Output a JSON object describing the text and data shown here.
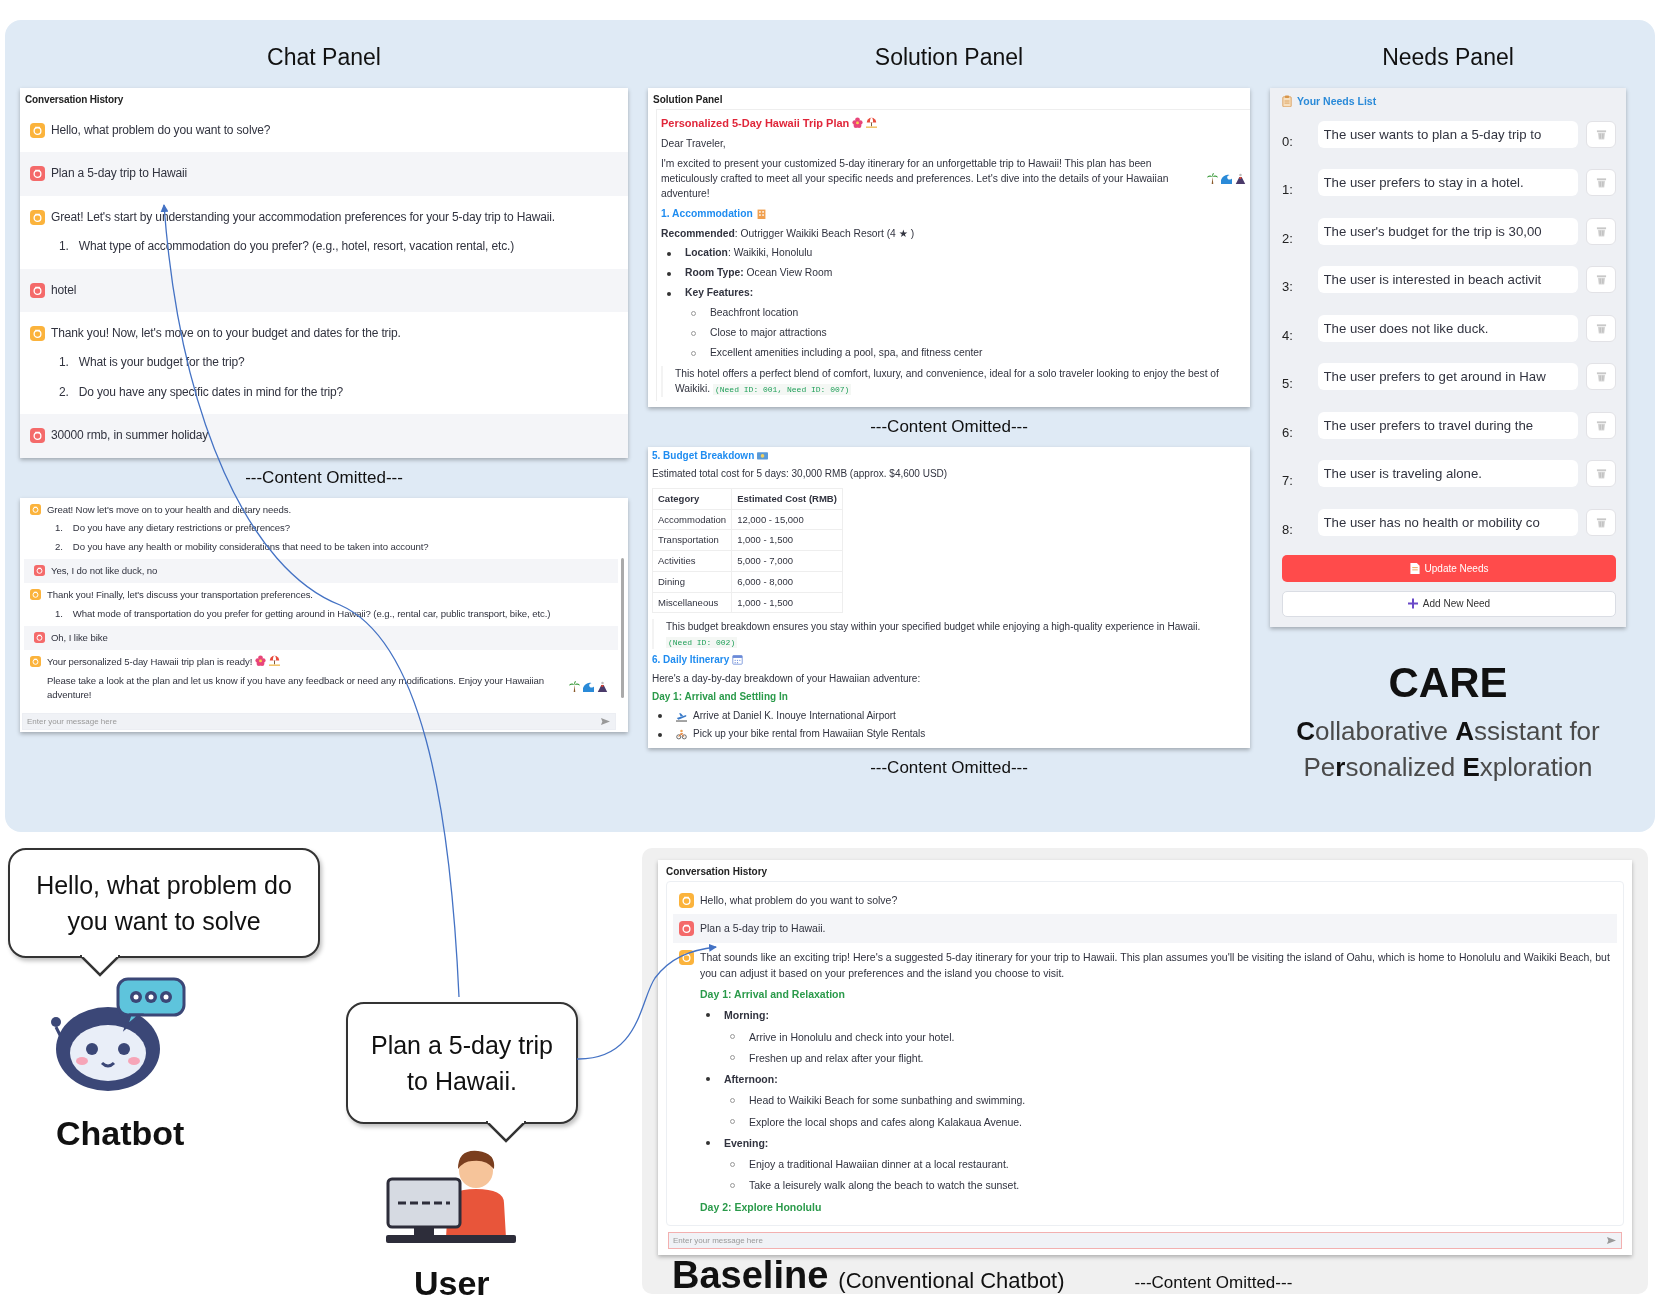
{
  "chat_panel": {
    "heading": "Chat Panel",
    "title": "Conversation History",
    "messages": [
      {
        "kind": "bot",
        "blocks": [
          {
            "kind": "paragraph",
            "text": "Hello, what problem do you want to solve?"
          }
        ]
      },
      {
        "kind": "user",
        "blocks": [
          {
            "kind": "paragraph",
            "text": "Plan a 5-day trip to Hawaii"
          }
        ]
      },
      {
        "kind": "bot",
        "blocks": [
          {
            "kind": "paragraph",
            "text": "Great! Let's start by understanding your accommodation preferences for your 5-day trip to Hawaii."
          },
          {
            "kind": "numbered",
            "number": "1.",
            "text": "What type of accommodation do you prefer? (e.g., hotel, resort, vacation rental, etc.)"
          }
        ]
      },
      {
        "kind": "user",
        "blocks": [
          {
            "kind": "paragraph",
            "text": "hotel"
          }
        ]
      },
      {
        "kind": "bot",
        "blocks": [
          {
            "kind": "paragraph",
            "text": "Thank you! Now, let's move on to your budget and dates for the trip."
          },
          {
            "kind": "numbered",
            "number": "1.",
            "text": "What is your budget for the trip?"
          },
          {
            "kind": "numbered",
            "number": "2.",
            "text": "Do you have any specific dates in mind for the trip?"
          }
        ]
      },
      {
        "kind": "user",
        "blocks": [
          {
            "kind": "paragraph",
            "text": "30000 rmb, in summer holiday"
          }
        ]
      }
    ],
    "omitted": "---Content Omitted---",
    "messages_2": [
      {
        "kind": "bot",
        "blocks": [
          {
            "kind": "paragraph",
            "text": "Great! Now let's move on to your health and dietary needs."
          },
          {
            "kind": "numbered",
            "number": "1.",
            "text": "Do you have any dietary restrictions or preferences?"
          },
          {
            "kind": "numbered",
            "number": "2.",
            "text": "Do you have any health or mobility considerations that need to be taken into account?"
          }
        ]
      },
      {
        "kind": "user",
        "blocks": [
          {
            "kind": "paragraph",
            "text": "Yes, I do not like duck, no"
          }
        ]
      },
      {
        "kind": "bot",
        "blocks": [
          {
            "kind": "paragraph",
            "text": "Thank you! Finally, let's discuss your transportation preferences."
          },
          {
            "kind": "numbered",
            "number": "1.",
            "text": "What mode of transportation do you prefer for getting around in Hawaii? (e.g., rental car, public transport, bike, etc.)"
          }
        ]
      },
      {
        "kind": "user",
        "blocks": [
          {
            "kind": "paragraph",
            "text": "Oh, I like bike"
          }
        ]
      },
      {
        "kind": "bot",
        "blocks": [
          {
            "kind": "paragraph",
            "text": "Your personalized 5-day Hawaii trip plan is ready!"
          },
          {
            "kind": "paragraph",
            "text": "Please take a look at the plan and let us know if you have any feedback or need any modifications. Enjoy your Hawaiian adventure!"
          }
        ]
      }
    ],
    "input_placeholder": "Enter your message here"
  },
  "solution_panel": {
    "heading": "Solution Panel",
    "title": "Solution Panel",
    "blocks_top": [
      {
        "kind": "title",
        "text": "Personalized 5-Day Hawaii Trip Plan"
      },
      {
        "kind": "paragraph",
        "text": "Dear Traveler,"
      },
      {
        "kind": "paragraph",
        "text": "I'm excited to present your customized 5-day itinerary for an unforgettable trip to Hawaii! This plan has been meticulously crafted to meet all your specific needs and preferences. Let's dive into the details of your Hawaiian adventure!"
      },
      {
        "kind": "section",
        "text": "1. Accommodation"
      },
      {
        "kind": "paragraph",
        "text": "**Recommended**: Outrigger Waikiki Beach Resort (4 ★ )"
      },
      {
        "kind": "bullet",
        "text": "**Location**: Waikiki, Honolulu"
      },
      {
        "kind": "bullet",
        "text": "**Room Type:** Ocean View Room"
      },
      {
        "kind": "heading_bullet",
        "text": "Key Features:"
      },
      {
        "kind": "subbullet",
        "text": "Beachfront location"
      },
      {
        "kind": "subbullet",
        "text": "Close to major attractions"
      },
      {
        "kind": "subbullet",
        "text": "Excellent amenities including a pool, spa, and fitness center"
      },
      {
        "kind": "note",
        "text": "This hotel offers a perfect blend of comfort, luxury, and convenience, ideal for a solo traveler looking to enjoy the best of Waikiki.",
        "tag": "(Need ID: 001, Need ID: 007)"
      }
    ],
    "omitted": "---Content Omitted---",
    "blocks_bottom": [
      {
        "kind": "section",
        "text": "5. Budget Breakdown"
      },
      {
        "kind": "paragraph",
        "text": "Estimated total cost for 5 days: 30,000 RMB (approx. $4,600 USD)"
      },
      {
        "kind": "table",
        "columns": [
          "Category",
          "Estimated Cost (RMB)"
        ],
        "rows": [
          [
            "Accommodation",
            "12,000 - 15,000"
          ],
          [
            "Transportation",
            "1,000 - 1,500"
          ],
          [
            "Activities",
            "5,000 - 7,000"
          ],
          [
            "Dining",
            "6,000 - 8,000"
          ],
          [
            "Miscellaneous",
            "1,000 - 1,500"
          ]
        ]
      },
      {
        "kind": "note",
        "text": "This budget breakdown ensures you stay within your specified budget while enjoying a high-quality experience in Hawaii.",
        "tag": "(Need ID: 002)"
      },
      {
        "kind": "section",
        "text": "6. Daily Itinerary"
      },
      {
        "kind": "paragraph",
        "text": "Here's a day-by-day breakdown of your Hawaiian adventure:"
      },
      {
        "kind": "day",
        "text": "Day 1: Arrival and Settling In"
      },
      {
        "kind": "bullet",
        "text": "Arrive at Daniel K. Inouye International Airport"
      },
      {
        "kind": "bullet",
        "text": "Pick up your bike rental from Hawaiian Style Rentals"
      }
    ],
    "omitted_2": "---Content Omitted---"
  },
  "needs_panel": {
    "heading": "Needs Panel",
    "title": "Your Needs List",
    "needs": [
      {
        "index": "0:",
        "text": "The user wants to plan a 5-day trip to"
      },
      {
        "index": "1:",
        "text": "The user prefers to stay in a hotel."
      },
      {
        "index": "2:",
        "text": "The user's budget for the trip is 30,00"
      },
      {
        "index": "3:",
        "text": "The user is interested in beach activit"
      },
      {
        "index": "4:",
        "text": "The user does not like duck."
      },
      {
        "index": "5:",
        "text": "The user prefers to get around in Haw"
      },
      {
        "index": "6:",
        "text": "The user prefers to travel during the"
      },
      {
        "index": "7:",
        "text": "The user is traveling alone."
      },
      {
        "index": "8:",
        "text": "The user has no health or mobility co"
      }
    ],
    "update_button": "Update Needs",
    "add_button": "Add New Need"
  },
  "care": {
    "title": "CARE",
    "subtitle": "**C**ollaborative **A**ssistant for Pe**r**sonalized **E**xploration"
  },
  "illustration": {
    "chatbot_bubble": "Hello, what problem do you want to solve",
    "chatbot_label": "Chatbot",
    "user_bubble": "Plan a 5-day trip to Hawaii.",
    "user_label": "User"
  },
  "baseline": {
    "title": "Conversation History",
    "messages": [
      {
        "kind": "bot",
        "blocks": [
          {
            "kind": "paragraph",
            "text": "Hello, what problem do you want to solve?"
          }
        ]
      },
      {
        "kind": "user",
        "blocks": [
          {
            "kind": "paragraph",
            "text": "Plan a 5-day trip to Hawaii."
          }
        ]
      },
      {
        "kind": "bot",
        "blocks": [
          {
            "kind": "paragraph",
            "text": "That sounds like an exciting trip! Here's a suggested 5-day itinerary for your trip to Hawaii. This plan assumes you'll be visiting the island of Oahu, which is home to Honolulu and Waikiki Beach, but you can adjust it based on your preferences and the island you choose to visit."
          },
          {
            "kind": "day",
            "text": "Day 1: Arrival and Relaxation"
          },
          {
            "kind": "heading_bullet",
            "text": "Morning:"
          },
          {
            "kind": "subbullet",
            "text": "Arrive in Honolulu and check into your hotel."
          },
          {
            "kind": "subbullet",
            "text": "Freshen up and relax after your flight."
          },
          {
            "kind": "heading_bullet",
            "text": "Afternoon:"
          },
          {
            "kind": "subbullet",
            "text": "Head to Waikiki Beach for some sunbathing and swimming."
          },
          {
            "kind": "subbullet",
            "text": "Explore the local shops and cafes along Kalakaua Avenue."
          },
          {
            "kind": "heading_bullet",
            "text": "Evening:"
          },
          {
            "kind": "subbullet",
            "text": "Enjoy a traditional Hawaiian dinner at a local restaurant."
          },
          {
            "kind": "subbullet",
            "text": "Take a leisurely walk along the beach to watch the sunset."
          },
          {
            "kind": "day",
            "text": "Day 2: Explore Honolulu"
          }
        ]
      }
    ],
    "input_placeholder": "Enter your message here",
    "caption": "Baseline",
    "caption_note": "(Conventional Chatbot)",
    "omitted": "---Content Omitted---"
  }
}
